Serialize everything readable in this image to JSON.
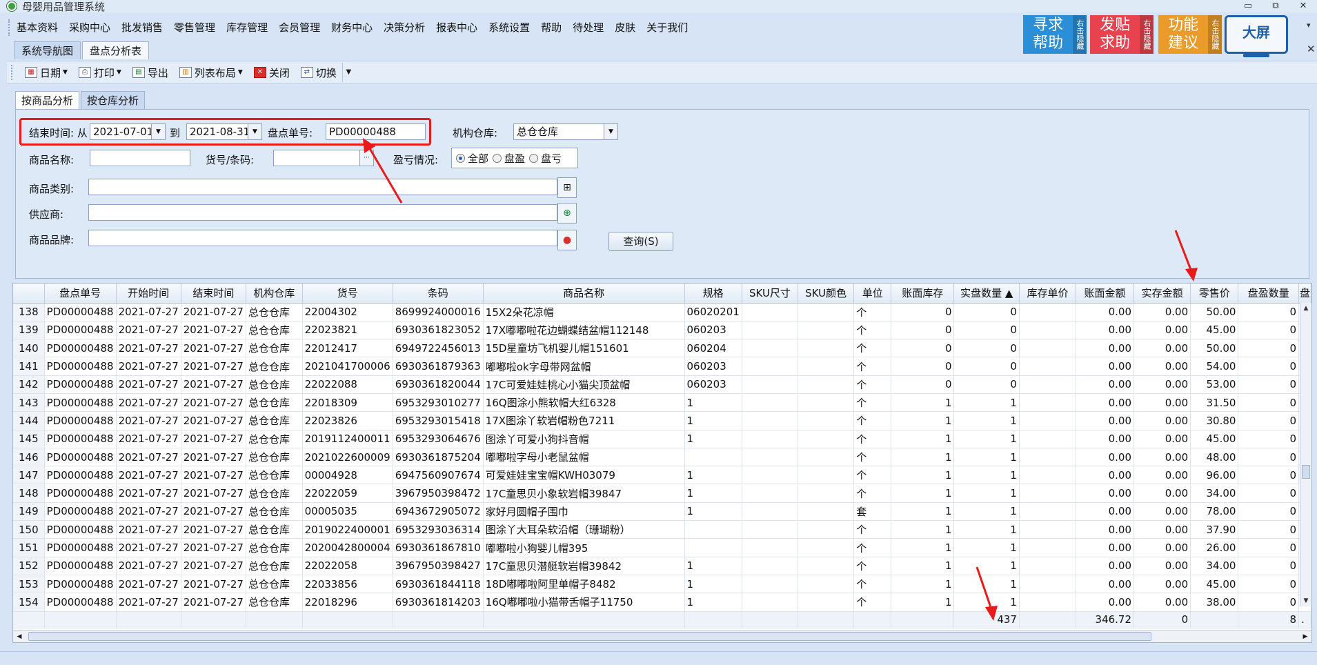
{
  "window": {
    "title": "母婴用品管理系统",
    "minimize": "▭",
    "restore": "⧉",
    "close": "✕"
  },
  "menu": [
    "基本资料",
    "采购中心",
    "批发销售",
    "零售管理",
    "库存管理",
    "会员管理",
    "财务中心",
    "决策分析",
    "报表中心",
    "系统设置",
    "帮助",
    "待处理",
    "皮肤",
    "关于我们"
  ],
  "promos": {
    "help": {
      "big": "寻求帮助",
      "small": "右击隐藏"
    },
    "sos": {
      "big": "发贴求助",
      "small": "右击隐藏"
    },
    "suggest": {
      "big": "功能建议",
      "small": "右击隐藏"
    },
    "bigscreen": "大屏",
    "chevron": "▾",
    "close": "✕"
  },
  "doc_tabs": [
    "系统导航图",
    "盘点分析表"
  ],
  "toolbar": {
    "date": "日期",
    "print": "打印",
    "export": "导出",
    "layout": "列表布局",
    "close": "关闭",
    "switch": "切换"
  },
  "filter_tabs": [
    "按商品分析",
    "按仓库分析"
  ],
  "filters": {
    "end_time_label": "结束时间: 从",
    "date_from": "2021-07-01",
    "to_label": "到",
    "date_to": "2021-08-31",
    "check_no_label": "盘点单号:",
    "check_no": "PD00000488",
    "warehouse_label": "机构仓库:",
    "warehouse": "总仓仓库",
    "product_name_label": "商品名称:",
    "product_name": "",
    "sku_label": "货号/条码:",
    "sku": "",
    "sku_more": "···",
    "profit_label": "盈亏情况:",
    "radio_all": "全部",
    "radio_gain": "盘盈",
    "radio_loss": "盘亏",
    "category_label": "商品类别:",
    "supplier_label": "供应商:",
    "brand_label": "商品品牌:",
    "query_button": "查询(S)"
  },
  "grid": {
    "columns": [
      "盘点单号",
      "开始时间",
      "结束时间",
      "机构仓库",
      "货号",
      "条码",
      "商品名称",
      "规格",
      "SKU尺寸",
      "SKU颜色",
      "单位",
      "账面库存",
      "实盘数量 ▲",
      "库存单价",
      "账面金额",
      "实存金额",
      "零售价",
      "盘盈数量",
      "盘"
    ],
    "rows": [
      [
        "138",
        "PD00000488",
        "2021-07-27",
        "2021-07-27",
        "总仓仓库",
        "22004302",
        "8699924000016",
        "15X2朵花凉帽",
        "06020201",
        "",
        "",
        "个",
        "0",
        "0",
        "",
        "0.00",
        "0.00",
        "50.00",
        "0"
      ],
      [
        "139",
        "PD00000488",
        "2021-07-27",
        "2021-07-27",
        "总仓仓库",
        "22023821",
        "6930361823052",
        "17X嘟嘟啦花边蝴蝶结盆帽112148",
        "060203",
        "",
        "",
        "个",
        "0",
        "0",
        "",
        "0.00",
        "0.00",
        "45.00",
        "0"
      ],
      [
        "140",
        "PD00000488",
        "2021-07-27",
        "2021-07-27",
        "总仓仓库",
        "22012417",
        "6949722456013",
        "15D星童坊飞机婴儿帽151601",
        "060204",
        "",
        "",
        "个",
        "0",
        "0",
        "",
        "0.00",
        "0.00",
        "50.00",
        "0"
      ],
      [
        "141",
        "PD00000488",
        "2021-07-27",
        "2021-07-27",
        "总仓仓库",
        "2021041700006",
        "6930361879363",
        "嘟嘟啦ok字母带网盆帽",
        "060203",
        "",
        "",
        "个",
        "0",
        "0",
        "",
        "0.00",
        "0.00",
        "54.00",
        "0"
      ],
      [
        "142",
        "PD00000488",
        "2021-07-27",
        "2021-07-27",
        "总仓仓库",
        "22022088",
        "6930361820044",
        "17C可爱娃娃桃心小猫尖顶盆帽",
        "060203",
        "",
        "",
        "个",
        "0",
        "0",
        "",
        "0.00",
        "0.00",
        "53.00",
        "0"
      ],
      [
        "143",
        "PD00000488",
        "2021-07-27",
        "2021-07-27",
        "总仓仓库",
        "22018309",
        "6953293010277",
        "16Q图涂小熊软帽大红6328",
        "1",
        "",
        "",
        "个",
        "1",
        "1",
        "",
        "0.00",
        "0.00",
        "31.50",
        "0"
      ],
      [
        "144",
        "PD00000488",
        "2021-07-27",
        "2021-07-27",
        "总仓仓库",
        "22023826",
        "6953293015418",
        "17X图涂丫软岩帽粉色7211",
        "1",
        "",
        "",
        "个",
        "1",
        "1",
        "",
        "0.00",
        "0.00",
        "30.80",
        "0"
      ],
      [
        "145",
        "PD00000488",
        "2021-07-27",
        "2021-07-27",
        "总仓仓库",
        "2019112400011",
        "6953293064676",
        "图涂丫可爱小狗抖音帽",
        "1",
        "",
        "",
        "个",
        "1",
        "1",
        "",
        "0.00",
        "0.00",
        "45.00",
        "0"
      ],
      [
        "146",
        "PD00000488",
        "2021-07-27",
        "2021-07-27",
        "总仓仓库",
        "2021022600009",
        "6930361875204",
        "嘟嘟啦字母小老鼠盆帽",
        "",
        "",
        "",
        "个",
        "1",
        "1",
        "",
        "0.00",
        "0.00",
        "48.00",
        "0"
      ],
      [
        "147",
        "PD00000488",
        "2021-07-27",
        "2021-07-27",
        "总仓仓库",
        "00004928",
        "6947560907674",
        "可爱娃娃宝宝帽KWH03079",
        "1",
        "",
        "",
        "个",
        "1",
        "1",
        "",
        "0.00",
        "0.00",
        "96.00",
        "0"
      ],
      [
        "148",
        "PD00000488",
        "2021-07-27",
        "2021-07-27",
        "总仓仓库",
        "22022059",
        "3967950398472",
        "17C童思贝小象软岩帽39847",
        "1",
        "",
        "",
        "个",
        "1",
        "1",
        "",
        "0.00",
        "0.00",
        "34.00",
        "0"
      ],
      [
        "149",
        "PD00000488",
        "2021-07-27",
        "2021-07-27",
        "总仓仓库",
        "00005035",
        "6943672905072",
        "家好月圆帽子围巾",
        "1",
        "",
        "",
        "套",
        "1",
        "1",
        "",
        "0.00",
        "0.00",
        "78.00",
        "0"
      ],
      [
        "150",
        "PD00000488",
        "2021-07-27",
        "2021-07-27",
        "总仓仓库",
        "2019022400001",
        "6953293036314",
        "图涂丫大耳朵软沿帽（珊瑚粉）",
        "",
        "",
        "",
        "个",
        "1",
        "1",
        "",
        "0.00",
        "0.00",
        "37.90",
        "0"
      ],
      [
        "151",
        "PD00000488",
        "2021-07-27",
        "2021-07-27",
        "总仓仓库",
        "2020042800004",
        "6930361867810",
        "嘟嘟啦小狗婴儿帽395",
        "",
        "",
        "",
        "个",
        "1",
        "1",
        "",
        "0.00",
        "0.00",
        "26.00",
        "0"
      ],
      [
        "152",
        "PD00000488",
        "2021-07-27",
        "2021-07-27",
        "总仓仓库",
        "22022058",
        "3967950398427",
        "17C童思贝潜艇软岩帽39842",
        "1",
        "",
        "",
        "个",
        "1",
        "1",
        "",
        "0.00",
        "0.00",
        "34.00",
        "0"
      ],
      [
        "153",
        "PD00000488",
        "2021-07-27",
        "2021-07-27",
        "总仓仓库",
        "22033856",
        "6930361844118",
        "18D嘟嘟啦阿里单帽子8482",
        "1",
        "",
        "",
        "个",
        "1",
        "1",
        "",
        "0.00",
        "0.00",
        "45.00",
        "0"
      ],
      [
        "154",
        "PD00000488",
        "2021-07-27",
        "2021-07-27",
        "总仓仓库",
        "22018296",
        "6930361814203",
        "16Q嘟嘟啦小猫带舌帽子11750",
        "1",
        "",
        "",
        "个",
        "1",
        "1",
        "",
        "0.00",
        "0.00",
        "38.00",
        "0"
      ]
    ],
    "footer": {
      "actual_qty": "437",
      "book_amount": "346.72",
      "actual_amount": "0",
      "gain_qty": "8",
      "more": "."
    }
  },
  "colors": {
    "highlight": "#ea1a1a",
    "accent": "#2a64b4"
  }
}
